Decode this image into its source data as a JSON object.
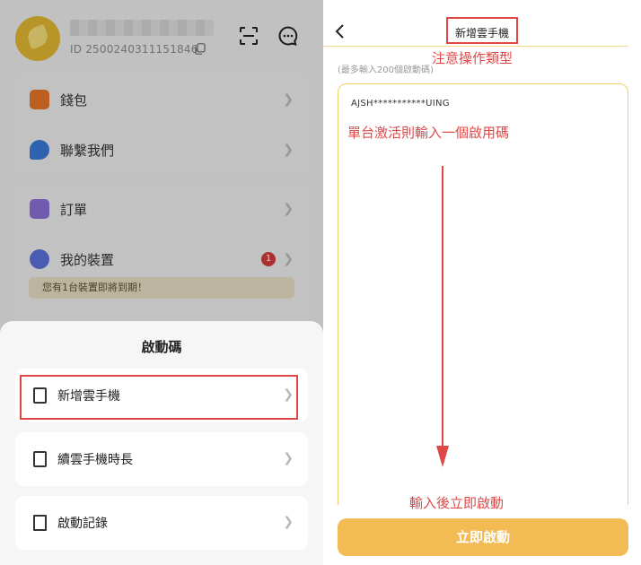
{
  "left": {
    "profile": {
      "user_id": "ID 2500240311151846",
      "avatar_color": "#e0b632",
      "icons": [
        "copy-icon",
        "scan-icon",
        "chat-icon"
      ]
    },
    "menu": [
      {
        "label": "錢包",
        "icon": "wallet-icon",
        "color": "#e8742a"
      },
      {
        "label": "聯繫我們",
        "icon": "chat-bubbles-icon",
        "color": "#3a79d8"
      },
      {
        "label": "訂單",
        "icon": "order-icon",
        "color": "#8c6fd6"
      },
      {
        "label": "我的裝置",
        "icon": "device-icon",
        "color": "#5b6fd9",
        "badge": "1"
      }
    ],
    "device_notice": "您有1台裝置即將到期！",
    "sheet": {
      "title": "啟動碼",
      "options": [
        {
          "label": "新增雲手機",
          "icon": "add-phone-icon"
        },
        {
          "label": "續雲手機時長",
          "icon": "renew-phone-icon"
        },
        {
          "label": "啟動記錄",
          "icon": "record-icon"
        }
      ]
    }
  },
  "right": {
    "title": "新增雲手機",
    "hint": "(最多輸入200個啟動碼)",
    "code_value": "AJSH***********UING",
    "button_label": "立即啟動",
    "accent_color": "#f2bb53",
    "annotations": {
      "title_note": "注意操作類型",
      "input_note": "單台激活則輸入一個啟用碼",
      "after_note": "輸入後立即啟動"
    }
  }
}
